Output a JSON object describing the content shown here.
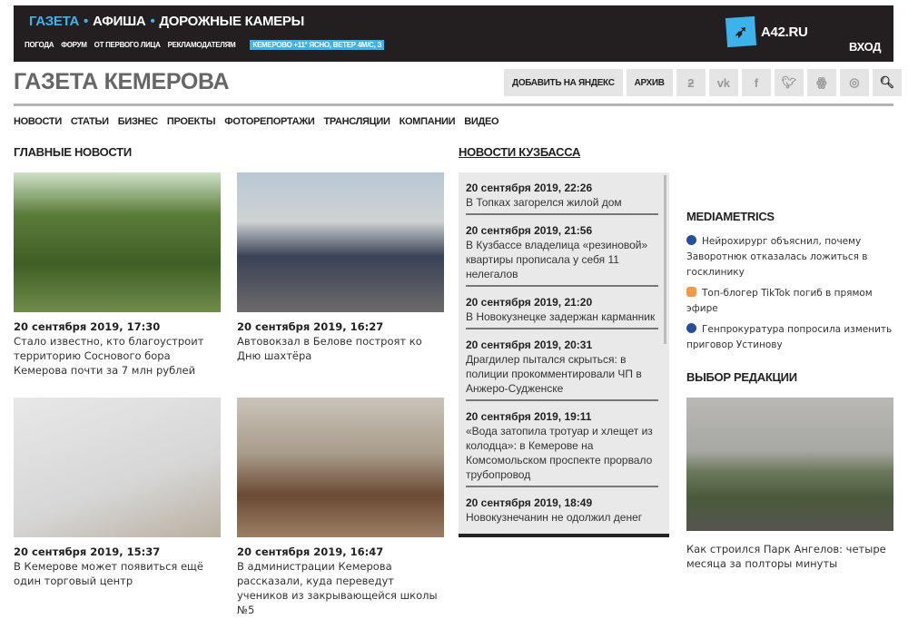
{
  "header": {
    "projects": [
      "ГАЗЕТА",
      "АФИША",
      "ДОРОЖНЫЕ КАМЕРЫ"
    ],
    "sublinks": [
      "ПОГОДА",
      "ФОРУМ",
      "ОТ ПЕРВОГО ЛИЦА",
      "РЕКЛАМОДАТЕЛЯМ"
    ],
    "weather": "КЕМЕРОВО +11° ЯСНО, ВЕТЕР 4М/С, З",
    "logo": "А42.RU",
    "login": "ВХОД"
  },
  "site_title": "ГАЗЕТА КЕМЕРОВА",
  "tools": {
    "yandex": "ДОБАВИТЬ НА ЯНДЕКС",
    "archive": "АРХИВ"
  },
  "nav": [
    "НОВОСТИ",
    "СТАТЬИ",
    "БИЗНЕС",
    "ПРОЕКТЫ",
    "ФОТОРЕПОРТАЖИ",
    "ТРАНСЛЯЦИИ",
    "КОМПАНИИ",
    "ВИДЕО"
  ],
  "main": {
    "heading": "ГЛАВНЫЕ НОВОСТИ",
    "cards": [
      {
        "date": "20 сентября 2019, 17:30",
        "title": "Стало известно, кто благоустроит территорию Соснового бора Кемерова почти за 7 млн рублей"
      },
      {
        "date": "20 сентября 2019, 16:27",
        "title": "Автовокзал в Белове построят ко Дню шахтёра"
      },
      {
        "date": "20 сентября 2019, 15:37",
        "title": "В Кемерове может появиться ещё один торговый центр"
      },
      {
        "date": "20 сентября 2019, 16:47",
        "title": "В администрации Кемерова рассказали, куда переведут учеников из закрывающейся школы №5"
      }
    ]
  },
  "kuzbass": {
    "heading": "НОВОСТИ КУЗБАССА",
    "items": [
      {
        "date": "20 сентября 2019, 22:26",
        "title": "В Топках загорелся жилой дом"
      },
      {
        "date": "20 сентября 2019, 21:56",
        "title": "В Кузбассе владелица «резиновой» квартиры прописала у себя 11 нелегалов"
      },
      {
        "date": "20 сентября 2019, 21:20",
        "title": "В Новокузнецке задержан карманник"
      },
      {
        "date": "20 сентября 2019, 20:31",
        "title": "Драгдилер пытался скрыться: в полиции прокомментировали ЧП в Анжеро-Судженске"
      },
      {
        "date": "20 сентября 2019, 19:11",
        "title": "«Вода затопила тротуар и хлещет из колодца»: в Кемерове на Комсомольском проспекте прорвало трубопровод"
      },
      {
        "date": "20 сентября 2019, 18:49",
        "title": "Новокузнечанин не одолжил денег"
      }
    ]
  },
  "mediametrics": {
    "heading": "MEDIAMETRICS",
    "items": [
      "Нейрохирург объяснил, почему Заворотнюк отказалась ложиться в госклинику",
      "Топ-блогер TikTok погиб в прямом эфире",
      "Генпрокуратура попросила изменить приговор Устинову"
    ]
  },
  "editors": {
    "heading": "ВЫБОР РЕДАКЦИИ",
    "caption": "Как строился Парк Ангелов: четыре месяца за полторы минуты"
  }
}
